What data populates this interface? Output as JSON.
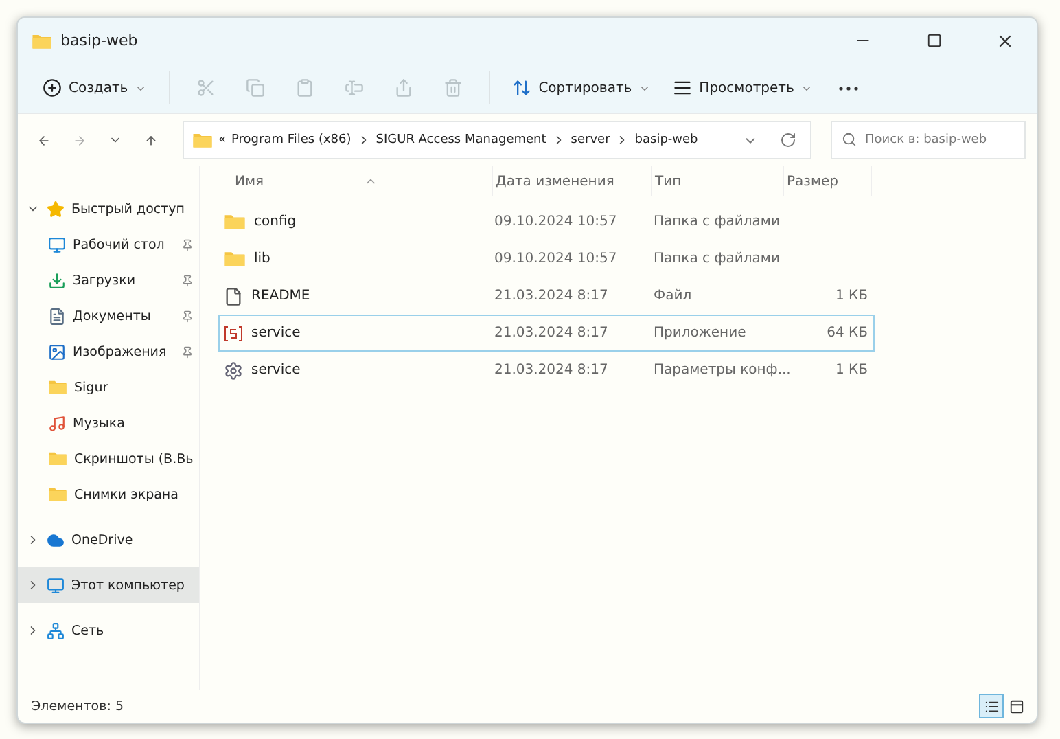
{
  "window": {
    "title": "basip-web"
  },
  "toolbar": {
    "new_button": {
      "label": "Создать",
      "has_menu": true
    },
    "actions": [
      {
        "kind": "cut",
        "disabled": true
      },
      {
        "kind": "copy",
        "disabled": true
      },
      {
        "kind": "paste",
        "disabled": true
      },
      {
        "kind": "rename",
        "disabled": true
      },
      {
        "kind": "share",
        "disabled": true
      },
      {
        "kind": "delete",
        "disabled": true
      }
    ],
    "sort_button": {
      "label": "Сортировать"
    },
    "view_button": {
      "label": "Просмотреть"
    }
  },
  "address_bar": {
    "overflow": "«",
    "path": [
      "Program Files (x86)",
      "SIGUR Access Management",
      "server",
      "basip-web"
    ]
  },
  "search": {
    "placeholder": "Поиск в: basip-web"
  },
  "sidebar": {
    "items": [
      {
        "label": "Быстрый доступ",
        "kind": "star",
        "expanded": true,
        "selected": false,
        "children": [
          {
            "label": "Рабочий стол",
            "kind": "desktop",
            "pinned": true,
            "selected": false
          },
          {
            "label": "Загрузки",
            "kind": "download",
            "pinned": true,
            "selected": false
          },
          {
            "label": "Документы",
            "kind": "document",
            "pinned": true,
            "selected": false
          },
          {
            "label": "Изображения",
            "kind": "pictures",
            "pinned": true,
            "selected": false
          },
          {
            "label": "Sigur",
            "kind": "folder",
            "pinned": false,
            "selected": false
          },
          {
            "label": "Музыка",
            "kind": "music",
            "pinned": false,
            "selected": false
          },
          {
            "label": "Скриншоты (B.Вь",
            "kind": "folder",
            "pinned": false,
            "selected": false
          },
          {
            "label": "Снимки экрана",
            "kind": "folder",
            "pinned": false,
            "selected": false
          }
        ]
      },
      {
        "label": "OneDrive",
        "kind": "cloud",
        "expanded": false,
        "selected": false
      },
      {
        "label": "Этот компьютер",
        "kind": "computer",
        "expanded": false,
        "selected": true
      },
      {
        "label": "Сеть",
        "kind": "network",
        "expanded": false,
        "selected": false
      }
    ]
  },
  "table": {
    "columns": [
      {
        "label": "Имя",
        "sorted": true
      },
      {
        "label": "Дата изменения",
        "sorted": false
      },
      {
        "label": "Тип",
        "sorted": false
      },
      {
        "label": "Размер",
        "sorted": false
      }
    ],
    "rows": [
      {
        "kind": "folder",
        "name": "config",
        "date": "09.10.2024 10:57",
        "type": "Папка с файлами",
        "selected": false
      },
      {
        "kind": "folder",
        "name": "lib",
        "date": "09.10.2024 10:57",
        "type": "Папка с файлами",
        "selected": false
      },
      {
        "kind": "file",
        "name": "README",
        "date": "21.03.2024 8:17",
        "type": "Файл",
        "size": "1 КБ",
        "selected": false
      },
      {
        "kind": "app",
        "name": "service",
        "date": "21.03.2024 8:17",
        "type": "Приложение",
        "size": "64 КБ",
        "selected": true
      },
      {
        "kind": "config",
        "name": "service",
        "date": "21.03.2024 8:17",
        "type": "Параметры конф...",
        "size": "1 КБ",
        "selected": false
      }
    ]
  },
  "status_bar": {
    "count": "Элементов: 5",
    "views": [
      {
        "kind": "details",
        "selected": true
      },
      {
        "kind": "tiles",
        "selected": false
      }
    ]
  }
}
